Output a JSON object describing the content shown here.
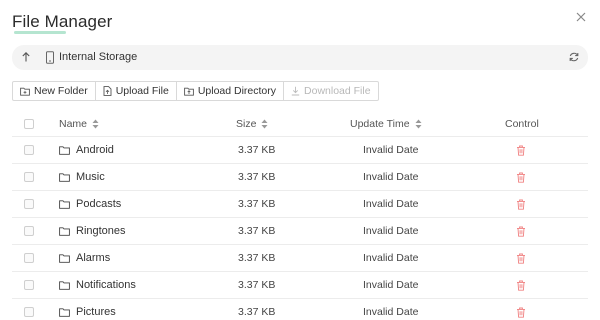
{
  "dialog": {
    "title": "File Manager"
  },
  "pathbar": {
    "location": "Internal Storage"
  },
  "toolbar": {
    "new_folder": "New Folder",
    "upload_file": "Upload File",
    "upload_directory": "Upload Directory",
    "download_file": "Download File"
  },
  "table": {
    "columns": {
      "name": "Name",
      "size": "Size",
      "update_time": "Update Time",
      "control": "Control"
    },
    "rows": [
      {
        "name": "Android",
        "size": "3.37 KB",
        "date": "Invalid Date"
      },
      {
        "name": "Music",
        "size": "3.37 KB",
        "date": "Invalid Date"
      },
      {
        "name": "Podcasts",
        "size": "3.37 KB",
        "date": "Invalid Date"
      },
      {
        "name": "Ringtones",
        "size": "3.37 KB",
        "date": "Invalid Date"
      },
      {
        "name": "Alarms",
        "size": "3.37 KB",
        "date": "Invalid Date"
      },
      {
        "name": "Notifications",
        "size": "3.37 KB",
        "date": "Invalid Date"
      },
      {
        "name": "Pictures",
        "size": "3.37 KB",
        "date": "Invalid Date"
      }
    ]
  },
  "icons": {
    "close": "close-icon",
    "up": "arrow-up-icon",
    "storage": "phone-icon",
    "refresh": "refresh-icon",
    "folder": "folder-icon",
    "delete": "trash-icon"
  },
  "colors": {
    "accent_underline": "#a8e0c8",
    "delete_icon": "#f08080",
    "disabled_text": "#b8b8b8"
  }
}
